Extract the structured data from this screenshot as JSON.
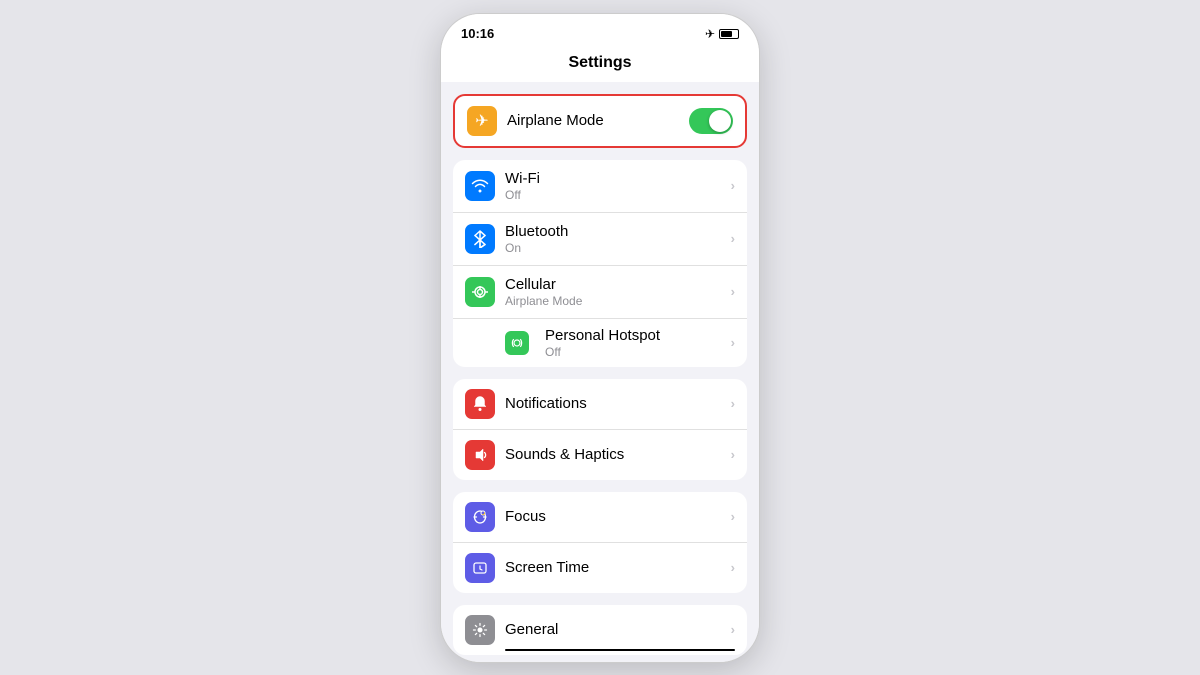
{
  "statusBar": {
    "time": "10:16",
    "airplane": "✈",
    "battery": ""
  },
  "title": "Settings",
  "sections": {
    "airplane": {
      "label": "Airplane Mode",
      "toggle": true,
      "highlighted": true
    },
    "connectivity": [
      {
        "id": "wifi",
        "label": "Wi-Fi",
        "sublabel": "Off",
        "iconBg": "bg-blue",
        "iconChar": "📶"
      },
      {
        "id": "bluetooth",
        "label": "Bluetooth",
        "sublabel": "On",
        "iconBg": "bg-bluetooth",
        "iconChar": "Ⓑ"
      },
      {
        "id": "cellular",
        "label": "Cellular",
        "sublabel": "Airplane Mode",
        "iconBg": "bg-green",
        "iconChar": "((·))"
      },
      {
        "id": "hotspot",
        "label": "Personal Hotspot",
        "sublabel": "Off",
        "iconBg": "bg-personal",
        "iconChar": "⛓"
      }
    ],
    "notifications": [
      {
        "id": "notifications",
        "label": "Notifications",
        "iconBg": "bg-red",
        "iconChar": "🔔"
      },
      {
        "id": "sounds",
        "label": "Sounds & Haptics",
        "iconBg": "bg-pink",
        "iconChar": "🔊"
      }
    ],
    "focus": [
      {
        "id": "focus",
        "label": "Focus",
        "iconBg": "bg-indigo",
        "iconChar": "🌙"
      },
      {
        "id": "screentime",
        "label": "Screen Time",
        "iconBg": "bg-indigo",
        "iconChar": "⏱"
      }
    ],
    "general": [
      {
        "id": "general",
        "label": "General",
        "iconBg": "bg-gray",
        "iconChar": "⚙"
      }
    ]
  },
  "chevron": "›"
}
